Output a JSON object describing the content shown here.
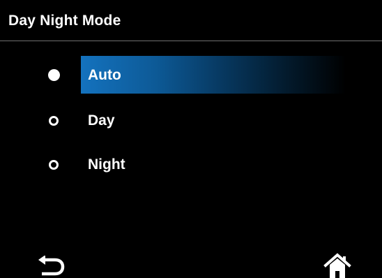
{
  "screen": {
    "title": "Day Night Mode"
  },
  "options": [
    {
      "label": "Auto",
      "selected": true
    },
    {
      "label": "Day",
      "selected": false
    },
    {
      "label": "Night",
      "selected": false
    }
  ],
  "footer": {
    "back_icon": "back-arrow-icon",
    "home_icon": "home-icon"
  },
  "colors": {
    "background": "#000000",
    "highlight": "#1472be",
    "text": "#ffffff"
  }
}
